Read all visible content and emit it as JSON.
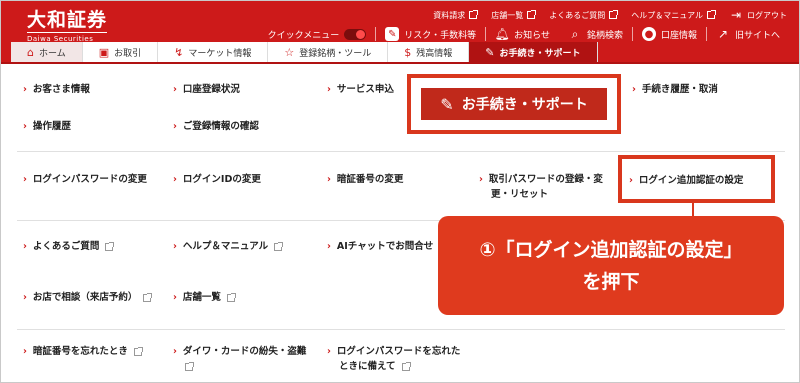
{
  "brand": {
    "logo_main": "大和証券",
    "logo_sub": "Daiwa Securities"
  },
  "toplinks": [
    {
      "label": "資料請求"
    },
    {
      "label": "店舗一覧"
    },
    {
      "label": "よくあるご質問"
    },
    {
      "label": "ヘルプ＆マニュアル"
    },
    {
      "label": "ログアウト"
    }
  ],
  "toolbar": {
    "quick_menu": "クイックメニュー",
    "risk": "リスク・手数料等",
    "notice": "お知らせ",
    "search": "銘柄検索",
    "account": "口座情報",
    "old_site": "旧サイトへ"
  },
  "nav": {
    "home": "ホーム",
    "trade": "お取引",
    "market": "マーケット情報",
    "register": "登録銘柄・ツール",
    "balance": "残高情報",
    "procedure": "お手続き・サポート"
  },
  "menu": {
    "customer_info": "お客さま情報",
    "account_status": "口座登録状況",
    "service_apply": "サービス申込",
    "procedure_history": "手続き履歴・取消",
    "operation_history": "操作履歴",
    "registered_info": "ご登録情報の確認",
    "login_pw_change": "ログインパスワードの変更",
    "login_id_change": "ログインIDの変更",
    "pin_change": "暗証番号の変更",
    "trade_pw": "取引パスワードの登録・変",
    "trade_pw_2": "更・リセット",
    "login_auth": "ログイン追加認証の設定",
    "faq": "よくあるご質問",
    "help": "ヘルプ＆マニュアル",
    "ai_chat": "AIチャットでお問合せ",
    "store_consult": "お店で相談（来店予約）",
    "store_list": "店舗一覧",
    "forgot_pin": "暗証番号を忘れたとき",
    "lost_card": "ダイワ・カードの紛失・盗難",
    "forgot_login_pw": "ログインパスワードを忘れた",
    "forgot_login_pw_2": "ときに備えて"
  },
  "callouts": {
    "procedure_label": "お手続き・サポート",
    "note_line1": "①「ログイン追加認証の設定」",
    "note_line2": "を押下"
  },
  "colors": {
    "brand_red": "#cd1a1a",
    "callout_orange": "#df3a1e"
  }
}
